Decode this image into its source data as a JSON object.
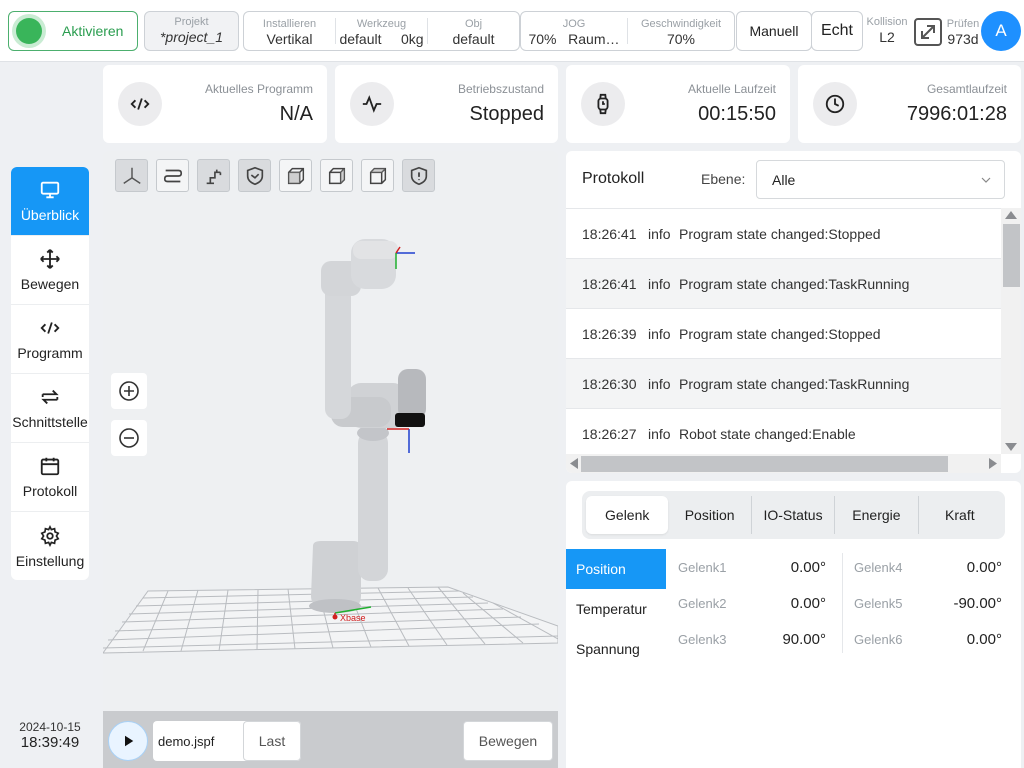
{
  "topbar": {
    "activate_label": "Aktivieren",
    "project": {
      "caption": "Projekt",
      "value": "*project_1"
    },
    "install": [
      {
        "caption": "Installieren",
        "value": "Vertikal"
      },
      {
        "caption": "Werkzeug",
        "value": "default     0kg"
      },
      {
        "caption": "Obj",
        "value": "default"
      }
    ],
    "jog": [
      {
        "caption": "JOG",
        "value": "70%   Raum…"
      },
      {
        "caption": "Geschwindigkeit",
        "value": "70%"
      }
    ],
    "manual_label": "Manuell",
    "real_label": "Echt",
    "collision": {
      "caption": "Kollision",
      "value": "L2"
    },
    "check": {
      "caption": "Prüfen",
      "value": "973d"
    },
    "avatar_letter": "A"
  },
  "sidebar": {
    "items": [
      {
        "label": "Überblick",
        "icon": "monitor-icon"
      },
      {
        "label": "Bewegen",
        "icon": "move-icon"
      },
      {
        "label": "Programm",
        "icon": "code-icon"
      },
      {
        "label": "Schnittstelle",
        "icon": "swap-icon"
      },
      {
        "label": "Protokoll",
        "icon": "calendar-icon"
      },
      {
        "label": "Einstellung",
        "icon": "gear-icon"
      }
    ],
    "date": "2024-10-15",
    "time": "18:39:49"
  },
  "cards": [
    {
      "label": "Aktuelles Programm",
      "value": "N/A",
      "icon": "code-icon"
    },
    {
      "label": "Betriebszustand",
      "value": "Stopped",
      "icon": "pulse-icon"
    },
    {
      "label": "Aktuelle Laufzeit",
      "value": "00:15:50",
      "icon": "watch-icon"
    },
    {
      "label": "Gesamtlaufzeit",
      "value": "7996:01:28",
      "icon": "clock-icon"
    }
  ],
  "viewport": {
    "axis_label": "Xbase",
    "file_name": "demo.jspf",
    "last_label": "Last",
    "move_label": "Bewegen"
  },
  "protocol": {
    "title": "Protokoll",
    "level_label": "Ebene:",
    "level_value": "Alle",
    "rows": [
      {
        "time": "18:26:41",
        "level": "info",
        "message": "Program state changed:Stopped"
      },
      {
        "time": "18:26:41",
        "level": "info",
        "message": "Program state changed:TaskRunning"
      },
      {
        "time": "18:26:39",
        "level": "info",
        "message": "Program state changed:Stopped"
      },
      {
        "time": "18:26:30",
        "level": "info",
        "message": "Program state changed:TaskRunning"
      },
      {
        "time": "18:26:27",
        "level": "info",
        "message": "Robot state changed:Enable"
      }
    ]
  },
  "joints": {
    "tabs": [
      "Gelenk",
      "Position",
      "IO-Status",
      "Energie",
      "Kraft"
    ],
    "subtabs": [
      "Position",
      "Temperatur",
      "Spannung"
    ],
    "left": [
      {
        "name": "Gelenk1",
        "value": "0.00°"
      },
      {
        "name": "Gelenk2",
        "value": "0.00°"
      },
      {
        "name": "Gelenk3",
        "value": "90.00°"
      }
    ],
    "right": [
      {
        "name": "Gelenk4",
        "value": "0.00°"
      },
      {
        "name": "Gelenk5",
        "value": "-90.00°"
      },
      {
        "name": "Gelenk6",
        "value": "0.00°"
      }
    ]
  }
}
